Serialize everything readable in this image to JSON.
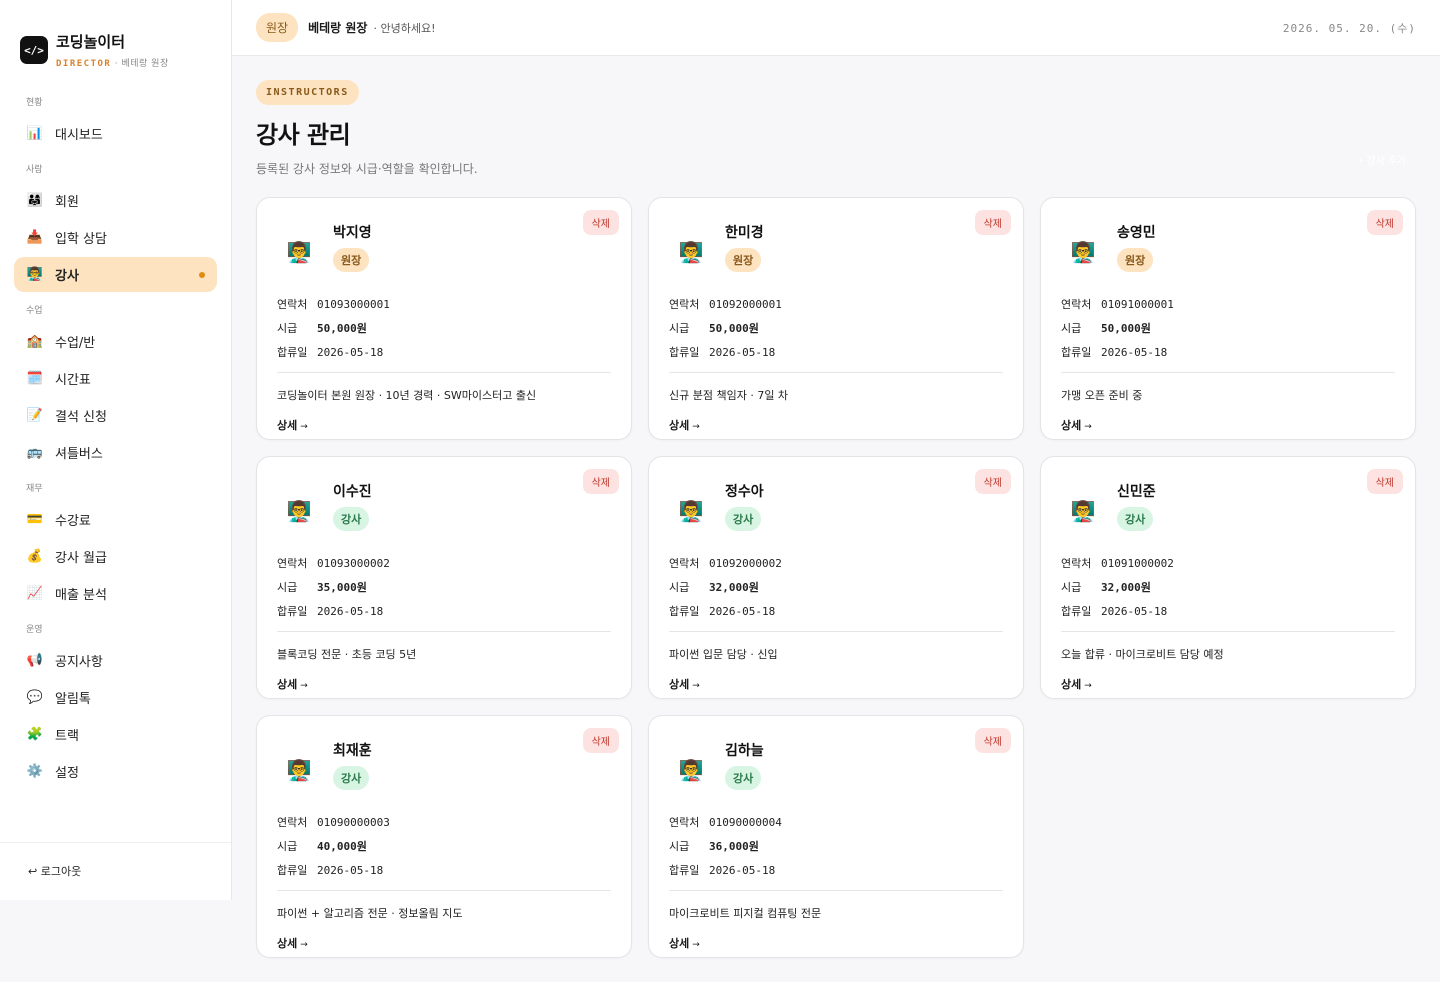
{
  "brand": {
    "name": "코딩놀이터",
    "logo": "</>",
    "role": "DIRECTOR",
    "sep": "·",
    "user": "베테랑 원장"
  },
  "nav": [
    {
      "type": "section",
      "label": "현황"
    },
    {
      "type": "item",
      "label": "대시보드",
      "icon": "📊",
      "name": "dashboard"
    },
    {
      "type": "section",
      "label": "사람"
    },
    {
      "type": "item",
      "label": "회원",
      "icon": "👨‍👩‍👧",
      "name": "members"
    },
    {
      "type": "item",
      "label": "입학 상담",
      "icon": "📥",
      "name": "admission"
    },
    {
      "type": "item",
      "label": "강사",
      "icon": "👨‍🏫",
      "name": "instructors",
      "active": true
    },
    {
      "type": "section",
      "label": "수업"
    },
    {
      "type": "item",
      "label": "수업/반",
      "icon": "🏫",
      "name": "classes"
    },
    {
      "type": "item",
      "label": "시간표",
      "icon": "🗓️",
      "name": "timetable"
    },
    {
      "type": "item",
      "label": "결석 신청",
      "icon": "📝",
      "name": "absence"
    },
    {
      "type": "item",
      "label": "셔틀버스",
      "icon": "🚌",
      "name": "shuttle"
    },
    {
      "type": "section",
      "label": "재무"
    },
    {
      "type": "item",
      "label": "수강료",
      "icon": "💳",
      "name": "tuition"
    },
    {
      "type": "item",
      "label": "강사 월급",
      "icon": "💰",
      "name": "salary"
    },
    {
      "type": "item",
      "label": "매출 분석",
      "icon": "📈",
      "name": "sales"
    },
    {
      "type": "section",
      "label": "운영"
    },
    {
      "type": "item",
      "label": "공지사항",
      "icon": "📢",
      "name": "notice"
    },
    {
      "type": "item",
      "label": "알림톡",
      "icon": "💬",
      "name": "alimtalk"
    },
    {
      "type": "item",
      "label": "트랙",
      "icon": "🧩",
      "name": "track"
    },
    {
      "type": "item",
      "label": "설정",
      "icon": "⚙️",
      "name": "settings"
    }
  ],
  "logout": "↩ 로그아웃",
  "topbar": {
    "role": "원장",
    "name": "베테랑 원장",
    "greeting": "· 안녕하세요!",
    "date": "2026. 05. 20. (수)"
  },
  "page": {
    "eyebrow": "INSTRUCTORS",
    "title": "강사 관리",
    "desc": "등록된 강사 정보와 시급·역할을 확인합니다.",
    "add": "+ 강사 추가"
  },
  "labels": {
    "contact": "연락처",
    "wage": "시급",
    "joined": "합류일",
    "delete": "삭제",
    "detail": "상세",
    "arrow": "→"
  },
  "instructors": [
    {
      "name": "박지영",
      "role": "원장",
      "roleType": "head",
      "contact": "01093000001",
      "wage": "50,000원",
      "joined": "2026-05-18",
      "note": "코딩놀이터 본원 원장 · 10년 경력 · SW마이스터고 출신"
    },
    {
      "name": "한미경",
      "role": "원장",
      "roleType": "head",
      "contact": "01092000001",
      "wage": "50,000원",
      "joined": "2026-05-18",
      "note": "신규 분점 책임자 · 7일 차"
    },
    {
      "name": "송영민",
      "role": "원장",
      "roleType": "head",
      "contact": "01091000001",
      "wage": "50,000원",
      "joined": "2026-05-18",
      "note": "가맹 오픈 준비 중"
    },
    {
      "name": "이수진",
      "role": "강사",
      "roleType": "inst",
      "contact": "01093000002",
      "wage": "35,000원",
      "joined": "2026-05-18",
      "note": "블록코딩 전문 · 초등 코딩 5년"
    },
    {
      "name": "정수아",
      "role": "강사",
      "roleType": "inst",
      "contact": "01092000002",
      "wage": "32,000원",
      "joined": "2026-05-18",
      "note": "파이썬 입문 담당 · 신입"
    },
    {
      "name": "신민준",
      "role": "강사",
      "roleType": "inst",
      "contact": "01091000002",
      "wage": "32,000원",
      "joined": "2026-05-18",
      "note": "오늘 합류 · 마이크로비트 담당 예정"
    },
    {
      "name": "최재훈",
      "role": "강사",
      "roleType": "inst",
      "contact": "01090000003",
      "wage": "40,000원",
      "joined": "2026-05-18",
      "note": "파이썬 + 알고리즘 전문 · 정보올림 지도"
    },
    {
      "name": "김하늘",
      "role": "강사",
      "roleType": "inst",
      "contact": "01090000004",
      "wage": "36,000원",
      "joined": "2026-05-18",
      "note": "마이크로비트 피지컬 컴퓨팅 전문"
    }
  ],
  "avatar_icon": "👨‍🏫",
  "colors": {
    "accent": "#fde3bf",
    "accent_text": "#8a5a1c",
    "dot": "#e38b10",
    "delete_bg": "#fde2e2",
    "delete_text": "#c0392b",
    "badge_inst_bg": "#d8f5e3",
    "badge_inst_text": "#2a7a4b"
  }
}
